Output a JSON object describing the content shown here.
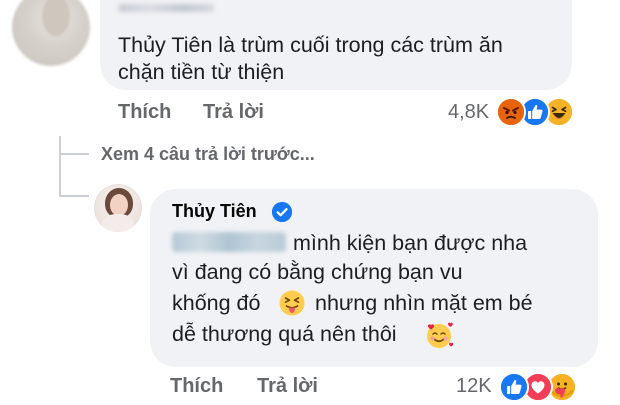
{
  "top_comment": {
    "text_line1": "Thủy Tiên là trùm cuối trong các trùm ăn",
    "text_line2": "chặn tiền từ thiện",
    "like_label": "Thích",
    "reply_label": "Trả lời",
    "reaction_count": "4,8K",
    "reactions": [
      "angry-icon",
      "like-icon",
      "haha-icon"
    ]
  },
  "view_previous_replies": "Xem 4 câu trả lời trước...",
  "reply": {
    "author": "Thủy Tiên",
    "verified": true,
    "text_line1": "mình kiện bạn được nha",
    "text_line2": "vì đang có bằng chứng bạn vu",
    "text_line3_a": "khống đó",
    "text_line3_b": "nhưng nhìn mặt em bé",
    "text_line4": "dễ thương quá nên thôi",
    "inline_emojis": [
      "tongue-squint-emoji-icon",
      "smiling-hearts-emoji-icon"
    ],
    "like_label": "Thích",
    "reply_label": "Trả lời",
    "reaction_count": "12K",
    "reactions": [
      "like-icon",
      "love-icon",
      "care-icon"
    ]
  },
  "colors": {
    "bubble_bg": "#f0f2f5",
    "secondary_text": "#65676b",
    "like_blue": "#1877f2",
    "love_red": "#f33e58",
    "angry_orange": "#e9710f",
    "haha_yellow": "#f7b125"
  }
}
